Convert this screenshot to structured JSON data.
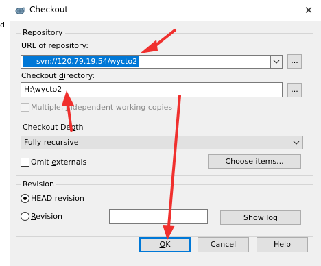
{
  "background": {
    "fragment_text": "d"
  },
  "window": {
    "title": "Checkout",
    "close_glyph": "✕"
  },
  "repository": {
    "legend": "Repository",
    "url_label_prefix": "",
    "url_label_accel": "U",
    "url_label_rest": "RL of repository:",
    "url_value": "svn://120.79.19.54/wycto2",
    "url_browse": "...",
    "dir_label_pre": "Checkout ",
    "dir_label_accel": "d",
    "dir_label_post": "irectory:",
    "dir_value": "H:\\wycto2",
    "dir_browse": "...",
    "multiple_label_pre": "Multiple, ",
    "multiple_label_accel": "i",
    "multiple_label_post": "ndependent working copies",
    "multiple_checked": false
  },
  "depth": {
    "legend_pre": "Checkout De",
    "legend_accel": "p",
    "legend_post": "th",
    "selected": "Fully recursive",
    "omit_label_pre": "Omit ",
    "omit_label_accel": "e",
    "omit_label_post": "xternals",
    "omit_checked": false,
    "choose_pre": "",
    "choose_accel": "C",
    "choose_post": "hoose items..."
  },
  "revision": {
    "legend": "Revision",
    "head_pre": "",
    "head_accel": "H",
    "head_post": "EAD revision",
    "head_selected": true,
    "rev_pre": "",
    "rev_accel": "R",
    "rev_post": "evision",
    "rev_value": "",
    "show_log_pre": "Show ",
    "show_log_accel": "l",
    "show_log_post": "og"
  },
  "buttons": {
    "ok_accel": "O",
    "ok_post": "K",
    "cancel": "Cancel",
    "help": "Help"
  },
  "colors": {
    "selection": "#0078d7",
    "annotation_arrow": "#f0302e"
  }
}
